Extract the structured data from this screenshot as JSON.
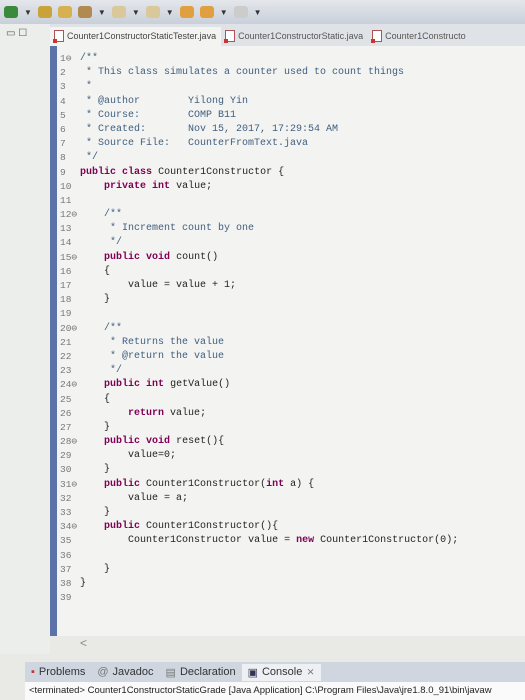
{
  "tabs": [
    {
      "label": "Counter1ConstructorStaticTester.java",
      "active": true
    },
    {
      "label": "Counter1ConstructorStatic.java",
      "active": false
    },
    {
      "label": "Counter1Constructo",
      "active": false
    }
  ],
  "code": {
    "keywords": [
      "public",
      "class",
      "private",
      "int",
      "void",
      "return",
      "new"
    ],
    "lines": [
      "/**",
      " * This class simulates a counter used to count things",
      " *",
      " * @author        Yilong Yin",
      " * Course:        COMP B11",
      " * Created:       Nov 15, 2017, 17:29:54 AM",
      " * Source File:   CounterFromText.java",
      " */",
      "public class Counter1Constructor {",
      "    private int value;",
      "",
      "    /**",
      "     * Increment count by one",
      "     */",
      "    public void count()",
      "    {",
      "        value = value + 1;",
      "    }",
      "",
      "    /**",
      "     * Returns the value",
      "     * @return the value",
      "     */",
      "    public int getValue()",
      "    {",
      "        return value;",
      "    }",
      "    public void reset(){",
      "        value=0;",
      "    }",
      "    public Counter1Constructor(int a) {",
      "        value = a;",
      "    }",
      "    public Counter1Constructor(){",
      "        Counter1Constructor value = new Counter1Constructor(0);",
      "",
      "    }",
      "}",
      ""
    ]
  },
  "scroll_left": "<",
  "bottom_tabs": [
    {
      "label": "Problems"
    },
    {
      "label": "Javadoc"
    },
    {
      "label": "Declaration"
    },
    {
      "label": "Console",
      "active": true
    }
  ],
  "console_close": "⨯",
  "console_status": "<terminated> Counter1ConstructorStaticGrade [Java Application] C:\\Program Files\\Java\\jre1.8.0_91\\bin\\javaw"
}
